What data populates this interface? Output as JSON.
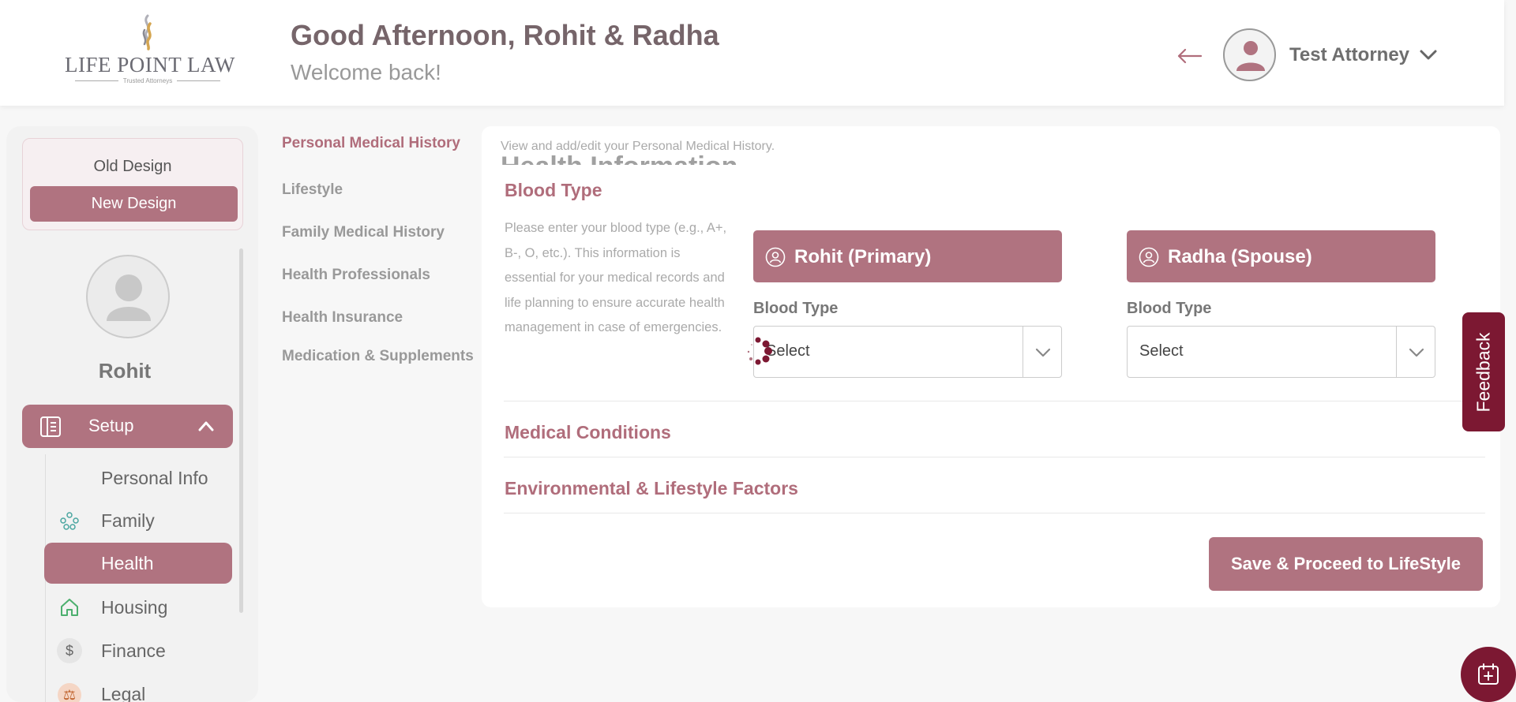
{
  "header": {
    "logo": {
      "name": "LIFE POINT LAW",
      "tagline": "Trusted Attorneys"
    },
    "greeting": "Good Afternoon, Rohit & Radha",
    "welcome": "Welcome back!",
    "user_name": "Test Attorney",
    "back_icon": "back-arrow-icon"
  },
  "sidebar": {
    "old_design": "Old Design",
    "new_design": "New Design",
    "profile_name": "Rohit",
    "setup_label": "Setup",
    "items": [
      {
        "label": "Personal Info",
        "icon": "none"
      },
      {
        "label": "Family",
        "icon": "family-icon"
      },
      {
        "label": "Health",
        "icon": "heart-icon",
        "active": true
      },
      {
        "label": "Housing",
        "icon": "home-icon"
      },
      {
        "label": "Finance",
        "icon": "dollar-icon"
      },
      {
        "label": "Legal",
        "icon": "legal-icon"
      }
    ]
  },
  "subtabs": [
    {
      "label": "Personal Medical History",
      "active": true
    },
    {
      "label": "Lifestyle"
    },
    {
      "label": "Family Medical History"
    },
    {
      "label": "Health Professionals"
    },
    {
      "label": "Health Insurance"
    },
    {
      "label": "Medication & Supplements"
    }
  ],
  "main": {
    "ghost_title": "Health Information",
    "ghost_subtitle": "View and add/edit your Personal Medical History.",
    "blood_type_section": {
      "title": "Blood Type",
      "description": "Please enter your blood type (e.g., A+, B-, O, etc.). This information is essential for your medical records and life planning to ensure accurate health management in case of emergencies.",
      "persons": [
        {
          "header": "Rohit (Primary)",
          "field_label": "Blood Type",
          "value": "Select"
        },
        {
          "header": "Radha (Spouse)",
          "field_label": "Blood Type",
          "value": "Select"
        }
      ]
    },
    "medical_conditions": "Medical Conditions",
    "environmental": "Environmental & Lifestyle Factors",
    "save_button": "Save & Proceed to LifeStyle"
  },
  "feedback": "Feedback",
  "colors": {
    "accent": "#b07380",
    "accent_text": "#b06d7b",
    "dark_maroon": "#7c1832"
  }
}
